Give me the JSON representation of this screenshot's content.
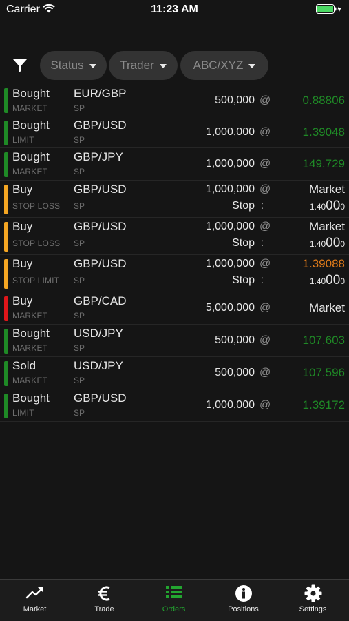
{
  "status_bar": {
    "carrier": "Carrier",
    "time": "11:23 AM"
  },
  "filters": [
    {
      "label": "Status"
    },
    {
      "label": "Trader"
    },
    {
      "label": "ABC/XYZ"
    }
  ],
  "orders": [
    {
      "side": "Bought",
      "type": "MARKET",
      "pair": "EUR/GBP",
      "product": "SP",
      "quantity": "500,000",
      "at": "@",
      "price": "0.88806",
      "price_color": "#1f8a26",
      "status_color": "#1f8a26"
    },
    {
      "side": "Bought",
      "type": "LIMIT",
      "pair": "GBP/USD",
      "product": "SP",
      "quantity": "1,000,000",
      "at": "@",
      "price": "1.39048",
      "price_color": "#1f8a26",
      "status_color": "#1f8a26"
    },
    {
      "side": "Bought",
      "type": "MARKET",
      "pair": "GBP/JPY",
      "product": "SP",
      "quantity": "1,000,000",
      "at": "@",
      "price": "149.729",
      "price_color": "#1f8a26",
      "status_color": "#1f8a26"
    },
    {
      "side": "Buy",
      "type": "STOP LOSS",
      "pair": "GBP/USD",
      "product": "SP",
      "quantity": "1,000,000",
      "at": "@",
      "price": "Market",
      "price_color": "#e6e6e6",
      "status_color": "#f5a623",
      "stop_label": "Stop",
      "stop_colon": ":",
      "stop_small": "1.40",
      "stop_big": "00",
      "stop_tail": "0"
    },
    {
      "side": "Buy",
      "type": "STOP LOSS",
      "pair": "GBP/USD",
      "product": "SP",
      "quantity": "1,000,000",
      "at": "@",
      "price": "Market",
      "price_color": "#e6e6e6",
      "status_color": "#f5a623",
      "stop_label": "Stop",
      "stop_colon": ":",
      "stop_small": "1.40",
      "stop_big": "00",
      "stop_tail": "0"
    },
    {
      "side": "Buy",
      "type": "STOP LIMIT",
      "pair": "GBP/USD",
      "product": "SP",
      "quantity": "1,000,000",
      "at": "@",
      "price": "1.39088",
      "price_color": "#e07b1a",
      "status_color": "#f5a623",
      "stop_label": "Stop",
      "stop_colon": ":",
      "stop_small": "1.40",
      "stop_big": "00",
      "stop_tail": "0"
    },
    {
      "side": "Buy",
      "type": "MARKET",
      "pair": "GBP/CAD",
      "product": "SP",
      "quantity": "5,000,000",
      "at": "@",
      "price": "Market",
      "price_color": "#e6e6e6",
      "status_color": "#e0161a"
    },
    {
      "side": "Bought",
      "type": "MARKET",
      "pair": "USD/JPY",
      "product": "SP",
      "quantity": "500,000",
      "at": "@",
      "price": "107.603",
      "price_color": "#1f8a26",
      "status_color": "#1f8a26"
    },
    {
      "side": "Sold",
      "type": "MARKET",
      "pair": "USD/JPY",
      "product": "SP",
      "quantity": "500,000",
      "at": "@",
      "price": "107.596",
      "price_color": "#1f8a26",
      "status_color": "#1f8a26"
    },
    {
      "side": "Bought",
      "type": "LIMIT",
      "pair": "GBP/USD",
      "product": "SP",
      "quantity": "1,000,000",
      "at": "@",
      "price": "1.39172",
      "price_color": "#1f8a26",
      "status_color": "#1f8a26"
    }
  ],
  "tabs": [
    {
      "label": "Market",
      "icon": "trend-chart-icon",
      "active": false
    },
    {
      "label": "Trade",
      "icon": "euro-icon",
      "active": false
    },
    {
      "label": "Orders",
      "icon": "list-icon",
      "active": true
    },
    {
      "label": "Positions",
      "icon": "info-icon",
      "active": false
    },
    {
      "label": "Settings",
      "icon": "gear-icon",
      "active": false
    }
  ],
  "colors": {
    "background": "#151515",
    "accent_green": "#23a530",
    "pill": "#333333"
  }
}
